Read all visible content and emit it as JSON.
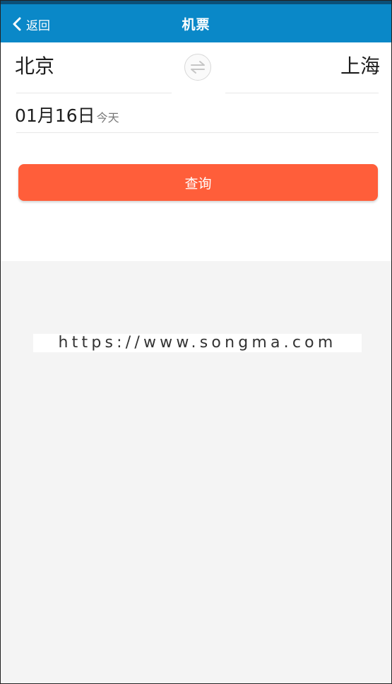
{
  "nav": {
    "back_label": "返回",
    "title": "机票"
  },
  "route": {
    "from_city": "北京",
    "to_city": "上海",
    "swap_icon": "swap-arrows-icon"
  },
  "date": {
    "value": "01月16日",
    "label": "今天"
  },
  "actions": {
    "search_label": "查询"
  },
  "watermark": {
    "text": "https://www.songma.com"
  },
  "colors": {
    "statusbar": "#0b4f78",
    "navbar": "#0a88c8",
    "search_button": "#ff5e3a",
    "page_background": "#f4f4f4"
  }
}
